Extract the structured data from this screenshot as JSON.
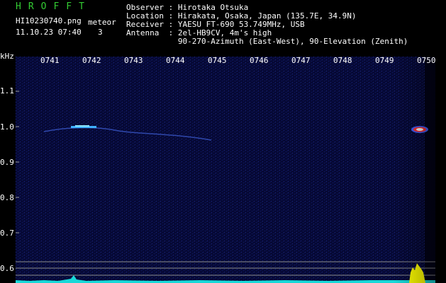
{
  "header": {
    "brand": "HROFFT",
    "filename": "HI10230740.png",
    "datetime": "11.10.23 07:40",
    "meteor_label": "meteor",
    "meteor_count": "3",
    "info_lines": [
      "Observer : Hirotaka Otsuka",
      "Location : Hirakata, Osaka, Japan (135.7E, 34.9N)",
      "Receiver : YAESU FT-690 53.749MHz, USB",
      "Antenna  : 2el-HB9CV, 4m's high",
      "           90-270-Azimuth (East-West), 90-Elevation (Zenith)"
    ]
  },
  "axes": {
    "y_unit": "kHz",
    "y_ticks": [
      "1.1",
      "1.0",
      "0.9",
      "0.8",
      "0.7",
      "0.6"
    ],
    "x_ticks": [
      "0741",
      "0742",
      "0743",
      "0744",
      "0745",
      "0746",
      "0747",
      "0748",
      "0749",
      "0750"
    ]
  },
  "colors": {
    "background": "#000000",
    "spectrogram": "#070a3a",
    "brand": "#33cc33",
    "text": "#ffffff",
    "signal": "#00ffff",
    "burst": "#ffff00"
  }
}
